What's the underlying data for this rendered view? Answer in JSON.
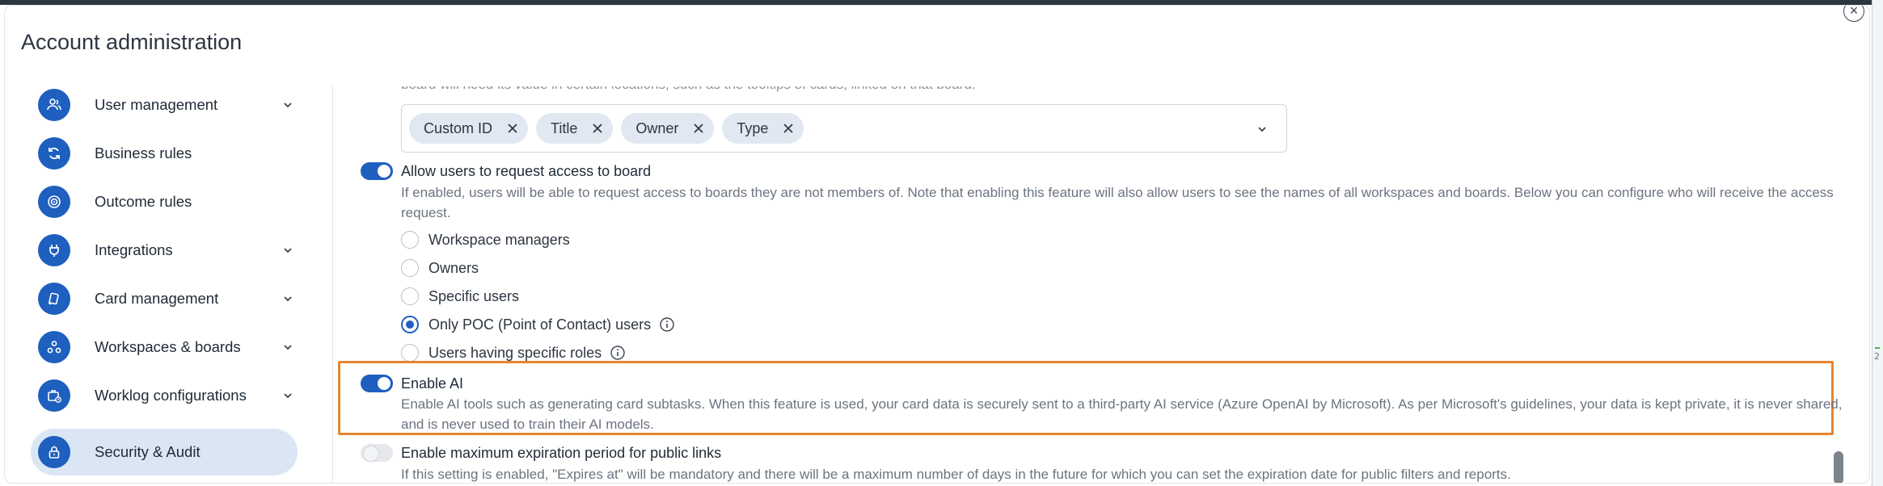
{
  "modal": {
    "title": "Account administration",
    "close_glyph": "×"
  },
  "sidebar": {
    "items": [
      {
        "label": "User management",
        "icon": "users-icon",
        "has_chevron": true,
        "active": false
      },
      {
        "label": "Business rules",
        "icon": "refresh-icon",
        "has_chevron": false,
        "active": false
      },
      {
        "label": "Outcome rules",
        "icon": "target-icon",
        "has_chevron": false,
        "active": false
      },
      {
        "label": "Integrations",
        "icon": "plug-icon",
        "has_chevron": true,
        "active": false
      },
      {
        "label": "Card management",
        "icon": "card-icon",
        "has_chevron": true,
        "active": false
      },
      {
        "label": "Workspaces & boards",
        "icon": "workspaces-icon",
        "has_chevron": true,
        "active": false
      },
      {
        "label": "Worklog configurations",
        "icon": "briefcase-clock-icon",
        "has_chevron": true,
        "active": false
      },
      {
        "label": "Security & Audit",
        "icon": "lock-icon",
        "has_chevron": false,
        "active": true
      }
    ]
  },
  "content": {
    "cut_off_text": "board will need its value in certain locations, such as the tooltips of cards, linked on that board.",
    "card_fields": {
      "chips": [
        "Custom ID",
        "Title",
        "Owner",
        "Type"
      ]
    },
    "request_access": {
      "enabled": true,
      "title": "Allow users to request access to board",
      "description": "If enabled, users will be able to request access to boards they are not members of. Note that enabling this feature will also allow users to see the names of all workspaces and boards. Below you can configure who will receive the access request.",
      "options": [
        {
          "label": "Workspace managers",
          "checked": false,
          "info": false
        },
        {
          "label": "Owners",
          "checked": false,
          "info": false
        },
        {
          "label": "Specific users",
          "checked": false,
          "info": false
        },
        {
          "label": "Only POC (Point of Contact) users",
          "checked": true,
          "info": true
        },
        {
          "label": "Users having specific roles",
          "checked": false,
          "info": true
        }
      ]
    },
    "enable_ai": {
      "enabled": true,
      "title": "Enable AI",
      "description": "Enable AI tools such as generating card subtasks. When this feature is used, your card data is securely sent to a third-party AI service (Azure OpenAI by Microsoft). As per Microsoft's guidelines, your data is kept private, it is never shared, and is never used to train their AI models."
    },
    "expiration": {
      "enabled": false,
      "title": "Enable maximum expiration period for public links",
      "description": "If this setting is enabled, \"Expires at\" will be mandatory and there will be a maximum number of days in the future for which you can set the expiration date for public filters and reports."
    }
  },
  "colors": {
    "accent": "#1e5fbf",
    "highlight": "#e6852f",
    "active_nav_bg": "#dbe6f5"
  },
  "edge_number": "2"
}
